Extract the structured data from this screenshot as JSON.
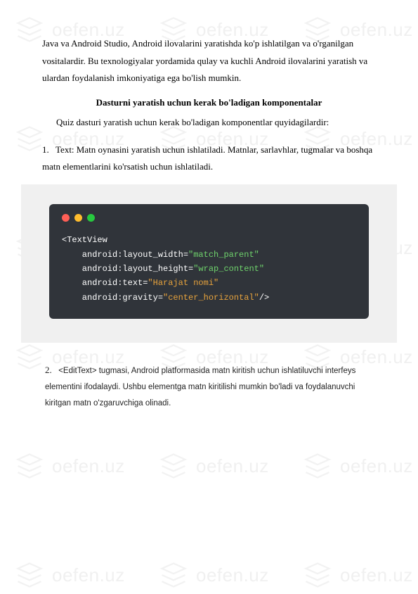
{
  "watermark_text": "oefen.uz",
  "paragraph1": "Java va Android Studio, Android ilovalarini yaratishda ko'p ishlatilgan va o'rganilgan vositalardir. Bu texnologiyalar yordamida qulay va kuchli Android ilovalarini yaratish va ulardan foydalanish imkoniyatiga ega bo'lish mumkin.",
  "heading1": "Dasturni yaratish uchun kerak bo'ladigan komponentalar",
  "paragraph2": "Quiz dasturi yaratish uchun kerak bo'ladigan komponentlar quyidagilardir:",
  "list_item_1_number": "1.",
  "list_item_1_text": "Text: Matn oynasini yaratish uchun ishlatiladi. Matnlar, sarlavhlar, tugmalar va boshqa matn elementlarini ko'rsatish uchun ishlatiladi.",
  "list_item_2_number": "2.",
  "list_item_2_text": "<EditText> tugmasi, Android platformasida matn kiritish uchun ishlatiluvchi interfeys elementini ifodalaydi. Ushbu elementga matn kiritilishi mumkin bo'ladi va foydalanuvchi kiritgan matn o'zgaruvchiga olinadi.",
  "code": {
    "line1_tag": "<TextView",
    "line2_attr": "    android:layout_width=",
    "line2_val": "\"match_parent\"",
    "line3_attr": "    android:layout_height=",
    "line3_val": "\"wrap_content\"",
    "line4_attr": "    android:text=",
    "line4_val": "\"Harajat nomi\"",
    "line5_attr": "    android:gravity=",
    "line5_val": "\"center_horizontal\"",
    "line5_close": "/>"
  }
}
